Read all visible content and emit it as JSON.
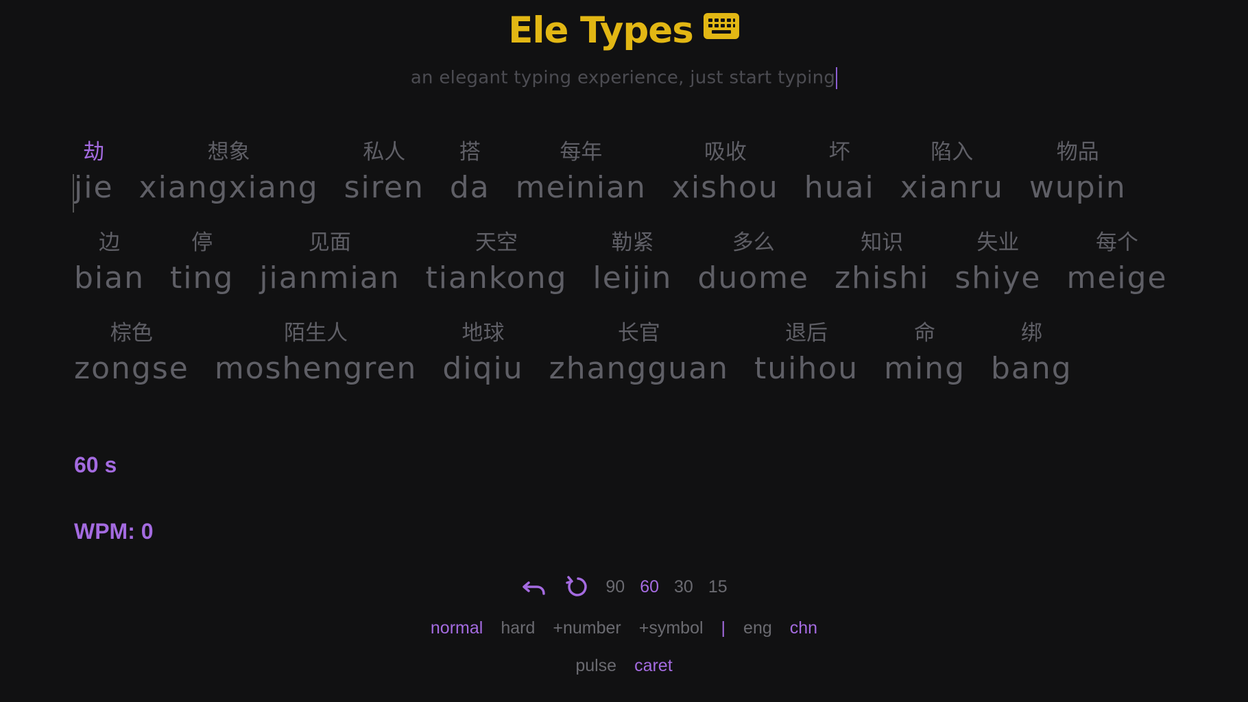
{
  "header": {
    "title": "Ele Types",
    "subtitle": "an elegant typing experience, just start typing",
    "icon": "keyboard-icon"
  },
  "colors": {
    "background": "#111112",
    "accent": "#a46be0",
    "title": "#e2b714",
    "muted": "#5f5f66"
  },
  "words": [
    [
      {
        "hanzi": "劫",
        "pinyin": "jie",
        "active": true
      },
      {
        "hanzi": "想象",
        "pinyin": "xiangxiang"
      },
      {
        "hanzi": "私人",
        "pinyin": "siren"
      },
      {
        "hanzi": "搭",
        "pinyin": "da"
      },
      {
        "hanzi": "每年",
        "pinyin": "meinian"
      },
      {
        "hanzi": "吸收",
        "pinyin": "xishou"
      },
      {
        "hanzi": "坏",
        "pinyin": "huai"
      },
      {
        "hanzi": "陷入",
        "pinyin": "xianru"
      },
      {
        "hanzi": "物品",
        "pinyin": "wupin"
      }
    ],
    [
      {
        "hanzi": "边",
        "pinyin": "bian"
      },
      {
        "hanzi": "停",
        "pinyin": "ting"
      },
      {
        "hanzi": "见面",
        "pinyin": "jianmian"
      },
      {
        "hanzi": "天空",
        "pinyin": "tiankong"
      },
      {
        "hanzi": "勒紧",
        "pinyin": "leijin"
      },
      {
        "hanzi": "多么",
        "pinyin": "duome"
      },
      {
        "hanzi": "知识",
        "pinyin": "zhishi"
      },
      {
        "hanzi": "失业",
        "pinyin": "shiye"
      },
      {
        "hanzi": "每个",
        "pinyin": "meige"
      }
    ],
    [
      {
        "hanzi": "棕色",
        "pinyin": "zongse"
      },
      {
        "hanzi": "陌生人",
        "pinyin": "moshengren"
      },
      {
        "hanzi": "地球",
        "pinyin": "diqiu"
      },
      {
        "hanzi": "长官",
        "pinyin": "zhangguan"
      },
      {
        "hanzi": "退后",
        "pinyin": "tuihou"
      },
      {
        "hanzi": "命",
        "pinyin": "ming"
      },
      {
        "hanzi": "绑",
        "pinyin": "bang"
      }
    ]
  ],
  "stats": {
    "timer": "60 s",
    "wpm": "WPM: 0"
  },
  "controls": {
    "undo_icon": "undo-icon",
    "restart_icon": "restart-icon",
    "durations": [
      {
        "label": "90",
        "selected": false
      },
      {
        "label": "60",
        "selected": true
      },
      {
        "label": "30",
        "selected": false
      },
      {
        "label": "15",
        "selected": false
      }
    ]
  },
  "modes": {
    "difficulty": [
      {
        "label": "normal",
        "selected": true
      },
      {
        "label": "hard",
        "selected": false
      },
      {
        "label": "+number",
        "selected": false
      },
      {
        "label": "+symbol",
        "selected": false
      }
    ],
    "separator": "|",
    "language": [
      {
        "label": "eng",
        "selected": false
      },
      {
        "label": "chn",
        "selected": true
      }
    ]
  },
  "caret_styles": [
    {
      "label": "pulse",
      "selected": false
    },
    {
      "label": "caret",
      "selected": true
    }
  ]
}
